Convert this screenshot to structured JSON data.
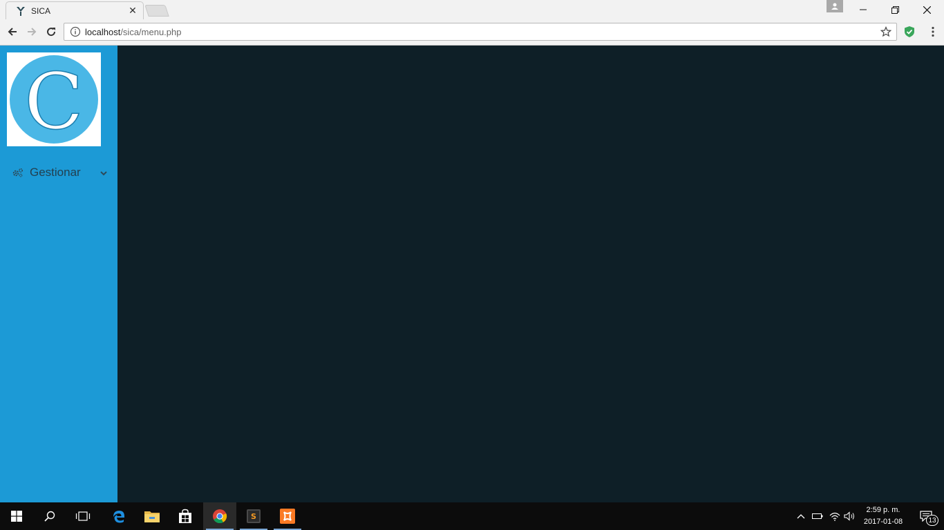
{
  "browser": {
    "tab_title": "SICA",
    "url_host": "localhost",
    "url_path": "/sica/menu.php"
  },
  "sidebar": {
    "logo_letter": "C",
    "menu": [
      {
        "label": "Gestionar",
        "icon": "gears-icon"
      }
    ]
  },
  "taskbar": {
    "time": "2:59 p. m.",
    "date": "2017-01-08",
    "notification_count": "13"
  },
  "colors": {
    "sidebar": "#1c9ad6",
    "content": "#0e1f27",
    "logo_circle": "#4ab7e6"
  }
}
